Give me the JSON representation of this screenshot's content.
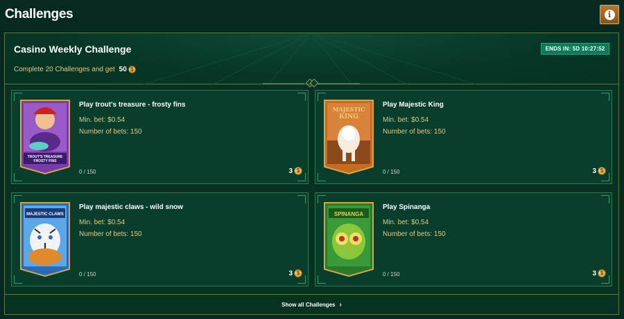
{
  "header": {
    "title": "Challenges",
    "info_icon": "info-icon"
  },
  "challenge": {
    "title": "Casino Weekly Challenge",
    "ends_in": "ENDS IN: 5D 10:27:52",
    "reward_text": "Complete 20 Challenges and get",
    "reward_amount": "50",
    "coin_symbol": "$"
  },
  "cards": [
    {
      "title": "Play trout's treasure - frosty fins",
      "min_bet": "Min. bet: $0.54",
      "num_bets": "Number of bets: 150",
      "progress": "0 / 150",
      "reward": "3",
      "coin_symbol": "$",
      "thumb_text": "TROUT'S TREASURE FROSTY FINS"
    },
    {
      "title": "Play Majestic King",
      "min_bet": "Min. bet: $0.54",
      "num_bets": "Number of bets: 150",
      "progress": "0 / 150",
      "reward": "3",
      "coin_symbol": "$",
      "thumb_text": "MAJESTIC KING"
    },
    {
      "title": "Play majestic claws - wild snow",
      "min_bet": "Min. bet: $0.54",
      "num_bets": "Number of bets: 150",
      "progress": "0 / 150",
      "reward": "3",
      "coin_symbol": "$",
      "thumb_text": "MAJESTIC CLAWS"
    },
    {
      "title": "Play Spinanga",
      "min_bet": "Min. bet: $0.54",
      "num_bets": "Number of bets: 150",
      "progress": "0 / 150",
      "reward": "3",
      "coin_symbol": "$",
      "thumb_text": "SPINANGA"
    }
  ],
  "footer": {
    "show_all": "Show all Challenges",
    "chevron_icon": "chevron-right-icon"
  },
  "colors": {
    "background": "#062a1f",
    "accent_gold": "#e8c87a",
    "badge": "#0f7a5a",
    "info_button": "#b8782c"
  }
}
